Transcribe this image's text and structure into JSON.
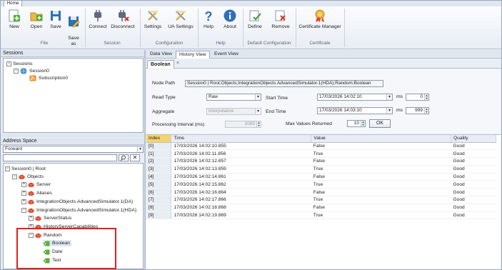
{
  "ribbon": {
    "tab_home": "Home",
    "buttons": {
      "new": "New",
      "open": "Open",
      "save": "Save",
      "save_as": "Save\nas",
      "connect": "Connect",
      "disconnect": "Disconnect",
      "settings": "Settings",
      "ua_settings": "UA Settings",
      "help": "Help",
      "about": "About",
      "define": "Define",
      "remove": "Remove",
      "certificate_manager": "Certificate Manager"
    },
    "groups": {
      "file": "File",
      "session": "Session",
      "configuration": "Configuration",
      "help": "Help",
      "default_configuration": "Default Configuration",
      "certificate": "Certificate"
    }
  },
  "sessions_panel": {
    "title": "Sessions",
    "tree": {
      "root": "Sessions",
      "session": "Session0",
      "subscription": "Subscription0"
    }
  },
  "address_space": {
    "title": "Address Space",
    "direction": "Forward",
    "search_value": "",
    "tree": {
      "root": "Session0 | Root",
      "objects": "Objects",
      "server": "Server",
      "aliases": "Aliases",
      "da": "IntegrationObjects.AdvancedSimulator.1(DA)",
      "hda": "IntegrationObjects.AdvancedSimulator.1(HDA)",
      "server_status": "ServerStatus",
      "history_caps": "HistoryServerCapabilities",
      "random": "Random",
      "boolean": "Boolean",
      "date": "Date",
      "text": "Text"
    }
  },
  "doc_tabs": [
    "Data View",
    "History View",
    "Event View"
  ],
  "active_doc_tab": "History View",
  "sub_tab": {
    "label": "Boolean",
    "close": "×"
  },
  "form": {
    "node_path_label": "Node Path",
    "node_path_value": "Session0 | Root;Objects;IntegrationObjects.AdvancedSimulator.1(HDA);Random;Boolean",
    "read_type_label": "Read Type",
    "read_type_value": "Raw",
    "aggregate_label": "Aggregate",
    "aggregate_value": "Interpolative",
    "processing_label": "Processing Interval (ms)",
    "processing_value": "1000",
    "start_time_label": "Start Time",
    "start_time_value": "17/03/2026 14:02:10",
    "end_time_label": "End Time",
    "end_time_value": "17/03/2026 14:03:10",
    "ms_label": "ms",
    "start_ms": "0",
    "end_ms": "999",
    "max_values_label": "Max Values Returned",
    "max_values": "10",
    "ok_button": "OK"
  },
  "table": {
    "columns": [
      "Index",
      "Time",
      "Value",
      "Quality"
    ],
    "rows": [
      [
        "[0]",
        "17/03/2026 14:02:10.855",
        "False",
        "Good"
      ],
      [
        "[1]",
        "17/03/2026 14:02:11.856",
        "True",
        "Good"
      ],
      [
        "[2]",
        "17/03/2026 14:02:12.857",
        "False",
        "Good"
      ],
      [
        "[3]",
        "17/03/2026 14:02:13.859",
        "True",
        "Good"
      ],
      [
        "[4]",
        "17/03/2026 14:02:14.861",
        "False",
        "Good"
      ],
      [
        "[5]",
        "17/03/2026 14:02:15.862",
        "True",
        "Good"
      ],
      [
        "[6]",
        "17/03/2026 14:02:16.864",
        "False",
        "Good"
      ],
      [
        "[7]",
        "17/03/2026 14:02:17.866",
        "True",
        "Good"
      ],
      [
        "[8]",
        "17/03/2026 14:02:18.868",
        "False",
        "Good"
      ],
      [
        "[9]",
        "17/03/2026 14:02:19.869",
        "True",
        "Good"
      ]
    ]
  },
  "colors": {
    "highlight_box": "#e0201a",
    "selected_header": "#f6d46a",
    "cube_red": "#d9472b",
    "tag_green": "#5cae3a"
  }
}
